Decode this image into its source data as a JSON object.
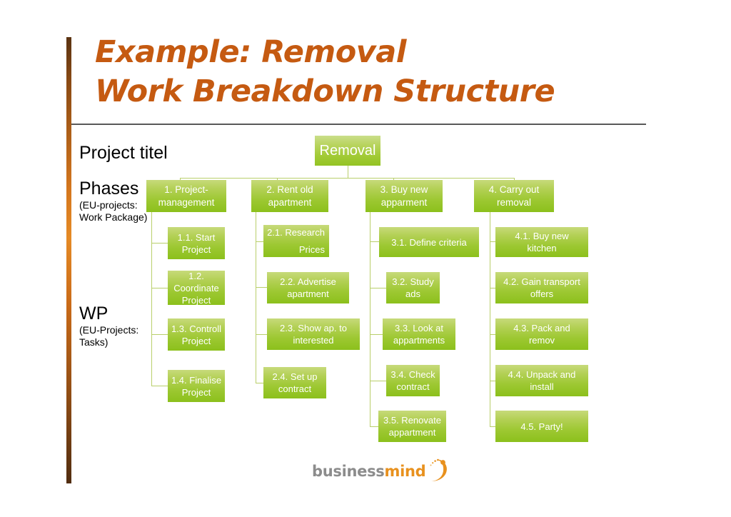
{
  "title": {
    "line1": "Example: Removal",
    "line2": "Work Breakdown Structure",
    "color": "#c55a11"
  },
  "row_labels": {
    "project_title": {
      "heading": "Project titel"
    },
    "phases": {
      "heading": "Phases",
      "sub_line1": "(EU-projects:",
      "sub_line2": "Work Package)"
    },
    "wp": {
      "heading": "WP",
      "sub_line1": "(EU-Projects:",
      "sub_line2": "Tasks)"
    }
  },
  "colors": {
    "box_gradient_top": "#c7da7a",
    "box_gradient_bottom": "#8cc01c",
    "connector": "#b9cf6b",
    "accent_bar": "#d4761d",
    "title_rule": "#595959"
  },
  "chart": {
    "root": {
      "label": "Removal"
    },
    "phases": [
      {
        "label_line1": "1. Project-",
        "label_line2": "management",
        "tasks": [
          {
            "line1": "1.1. Start",
            "line2": "Project"
          },
          {
            "line1": "1.2.",
            "line2": "Coordinate",
            "line3": "Project"
          },
          {
            "line1": "1.3. Controll",
            "line2": "Project"
          },
          {
            "line1": "1.4. Finalise",
            "line2": "Project"
          }
        ]
      },
      {
        "label_line1": "2. Rent old",
        "label_line2": "apartment",
        "tasks": [
          {
            "line1": "2.1. Research",
            "line2": "Prices"
          },
          {
            "line1": "2.2. Advertise",
            "line2": "apartment"
          },
          {
            "line1": "2.3. Show ap. to",
            "line2": "interested"
          },
          {
            "line1": "2.4. Set up",
            "line2": "contract"
          }
        ]
      },
      {
        "label_line1": "3. Buy new",
        "label_line2": "apparment",
        "tasks": [
          {
            "line1": "3.1. Define criteria",
            "line2": ""
          },
          {
            "line1": "3.2. Study",
            "line2": "ads"
          },
          {
            "line1": "3.3. Look at",
            "line2": "appartments"
          },
          {
            "line1": "3.4. Check",
            "line2": "contract"
          },
          {
            "line1": "3.5. Renovate",
            "line2": "appartment"
          }
        ]
      },
      {
        "label_line1": "4. Carry out",
        "label_line2": "removal",
        "tasks": [
          {
            "line1": "4.1. Buy new",
            "line2": "kitchen"
          },
          {
            "line1": "4.2. Gain transport",
            "line2": "offers"
          },
          {
            "line1": "4.3. Pack and",
            "line2": "remov"
          },
          {
            "line1": "4.4. Unpack and",
            "line2": "install"
          },
          {
            "line1": "4.5. Party!",
            "line2": ""
          }
        ]
      }
    ]
  },
  "logo": {
    "part1": "business",
    "part2": "mind"
  }
}
